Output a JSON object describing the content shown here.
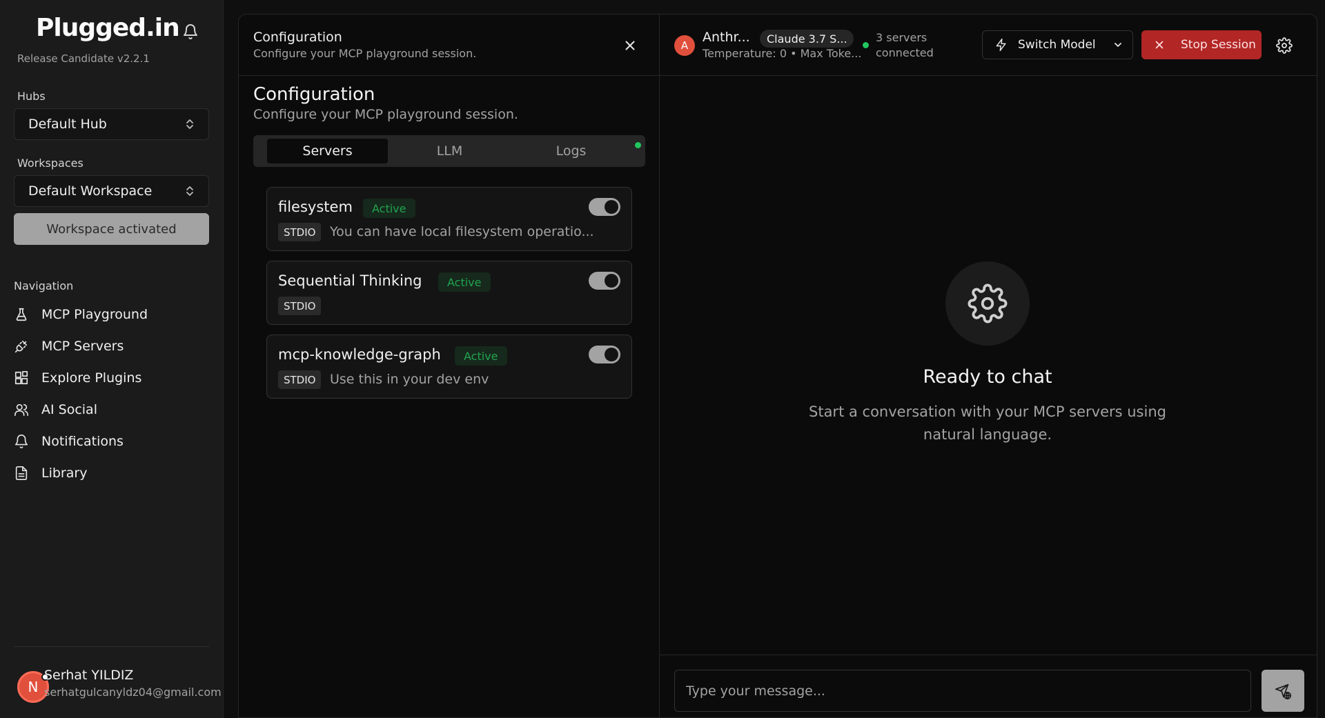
{
  "sidebar": {
    "logo": "Plugged.in",
    "version": "Release Candidate v2.2.1",
    "hubs_label": "Hubs",
    "hub_selected": "Default Hub",
    "workspaces_label": "Workspaces",
    "workspace_selected": "Default Workspace",
    "workspace_button": "Workspace activated",
    "navigation_label": "Navigation",
    "nav_items": [
      {
        "label": "MCP Playground",
        "icon": "flask-icon"
      },
      {
        "label": "MCP Servers",
        "icon": "plug-icon"
      },
      {
        "label": "Explore Plugins",
        "icon": "blocks-icon"
      },
      {
        "label": "AI Social",
        "icon": "users-icon"
      },
      {
        "label": "Notifications",
        "icon": "bell-icon"
      },
      {
        "label": "Library",
        "icon": "file-text-icon"
      }
    ],
    "user": {
      "initial": "N",
      "name": "Serhat YILDIZ",
      "email": "serhatgulcanyldz04@gmail.com"
    }
  },
  "config": {
    "header_title": "Configuration",
    "header_subtitle": "Configure your MCP playground session.",
    "title": "Configuration",
    "subtitle": "Configure your MCP playground session.",
    "tabs": [
      {
        "label": "Servers",
        "active": true
      },
      {
        "label": "LLM",
        "active": false
      },
      {
        "label": "Logs",
        "active": false
      }
    ],
    "servers": [
      {
        "name": "filesystem",
        "status": "Active",
        "type": "STDIO",
        "description": "You can have local filesystem operatio...",
        "enabled": true
      },
      {
        "name": "Sequential Thinking",
        "status": "Active",
        "type": "STDIO",
        "description": "",
        "enabled": true
      },
      {
        "name": "mcp-knowledge-graph",
        "status": "Active",
        "type": "STDIO",
        "description": "Use this in your dev env",
        "enabled": true
      }
    ]
  },
  "chat": {
    "model_initial": "A",
    "provider": "Anthr...",
    "model_chip": "Claude 3.7 S...",
    "model_params": "Temperature: 0 • Max Toke...",
    "status_text": "3 servers connected",
    "switch_model_label": "Switch Model",
    "stop_session_label": "Stop Session",
    "empty_title": "Ready to chat",
    "empty_description": "Start a conversation with your MCP servers using natural language.",
    "input_placeholder": "Type your message...",
    "input_value": ""
  },
  "colors": {
    "accent_green": "#22c55e",
    "stop_red": "#b32626",
    "avatar_orange": "#e0503c"
  }
}
